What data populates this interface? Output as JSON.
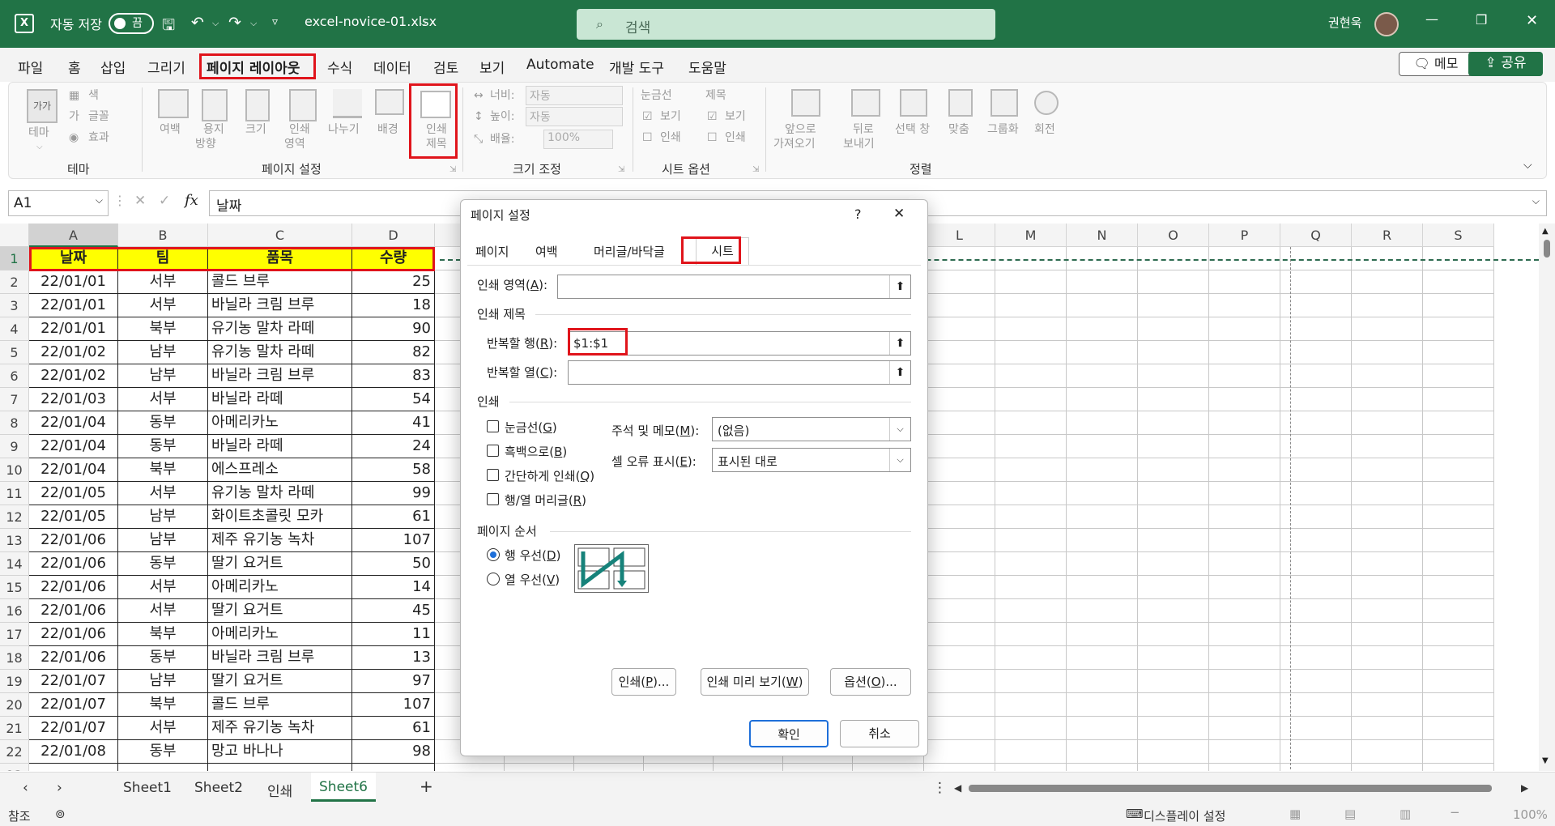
{
  "titlebar": {
    "autosave_label": "자동 저장",
    "autosave_state": "끔",
    "filename": "excel-novice-01.xlsx",
    "search_placeholder": "검색",
    "user_name": "권현욱"
  },
  "menu": {
    "items": [
      "파일",
      "홈",
      "삽입",
      "그리기",
      "페이지 레이아웃",
      "수식",
      "데이터",
      "검토",
      "보기",
      "Automate",
      "개발 도구",
      "도움말"
    ],
    "memo_label": "메모",
    "share_label": "공유"
  },
  "ribbon": {
    "theme": {
      "label": "테마",
      "btn": "테마",
      "color": "색",
      "font": "글꼴",
      "effect": "효과"
    },
    "page_setup": {
      "label": "페이지 설정",
      "margins": "여백",
      "orientation_1": "용지",
      "orientation_2": "방향",
      "size": "크기",
      "print_area_1": "인쇄",
      "print_area_2": "영역",
      "breaks": "나누기",
      "background": "배경",
      "print_titles_1": "인쇄",
      "print_titles_2": "제목"
    },
    "scale": {
      "label": "크기 조정",
      "width": "너비:",
      "width_val": "자동",
      "height": "높이:",
      "height_val": "자동",
      "scale": "배율:",
      "scale_val": "100%"
    },
    "sheet_options": {
      "label": "시트 옵션",
      "gridlines": "눈금선",
      "headings": "제목",
      "view": "보기",
      "print": "인쇄"
    },
    "arrange": {
      "label": "정렬",
      "bring_forward_1": "앞으로",
      "bring_forward_2": "가져오기",
      "send_backward_1": "뒤로",
      "send_backward_2": "보내기",
      "selection_pane": "선택 창",
      "align": "맞춤",
      "group": "그룹화",
      "rotate": "회전"
    }
  },
  "formula_bar": {
    "name_box": "A1",
    "fx": "fx",
    "value": "날짜"
  },
  "grid": {
    "columns": [
      "A",
      "B",
      "C",
      "D",
      "E",
      "F",
      "G",
      "H",
      "I",
      "J",
      "K",
      "L",
      "M",
      "N",
      "O",
      "P",
      "Q",
      "R",
      "S"
    ],
    "header_row": [
      "날짜",
      "팀",
      "품목",
      "수량"
    ],
    "rows": [
      [
        "22/01/01",
        "서부",
        "콜드 브루",
        "25"
      ],
      [
        "22/01/01",
        "서부",
        "바닐라 크림 브루",
        "18"
      ],
      [
        "22/01/01",
        "북부",
        "유기농 말차 라떼",
        "90"
      ],
      [
        "22/01/02",
        "남부",
        "유기농 말차 라떼",
        "82"
      ],
      [
        "22/01/02",
        "남부",
        "바닐라 크림 브루",
        "83"
      ],
      [
        "22/01/03",
        "서부",
        "바닐라 라떼",
        "54"
      ],
      [
        "22/01/04",
        "동부",
        "아메리카노",
        "41"
      ],
      [
        "22/01/04",
        "동부",
        "바닐라 라떼",
        "24"
      ],
      [
        "22/01/04",
        "북부",
        "에스프레소",
        "58"
      ],
      [
        "22/01/05",
        "서부",
        "유기농 말차 라떼",
        "99"
      ],
      [
        "22/01/05",
        "남부",
        "화이트초콜릿 모카",
        "61"
      ],
      [
        "22/01/06",
        "남부",
        "제주 유기농 녹차",
        "107"
      ],
      [
        "22/01/06",
        "동부",
        "딸기 요거트",
        "50"
      ],
      [
        "22/01/06",
        "서부",
        "아메리카노",
        "14"
      ],
      [
        "22/01/06",
        "서부",
        "딸기 요거트",
        "45"
      ],
      [
        "22/01/06",
        "북부",
        "아메리카노",
        "11"
      ],
      [
        "22/01/06",
        "동부",
        "바닐라 크림 브루",
        "13"
      ],
      [
        "22/01/07",
        "남부",
        "딸기 요거트",
        "97"
      ],
      [
        "22/01/07",
        "북부",
        "콜드 브루",
        "107"
      ],
      [
        "22/01/07",
        "서부",
        "제주 유기농 녹차",
        "61"
      ],
      [
        "22/01/08",
        "동부",
        "망고 바나나",
        "98"
      ]
    ]
  },
  "sheets": {
    "tabs": [
      "Sheet1",
      "Sheet2",
      "인쇄",
      "Sheet6"
    ],
    "active": "Sheet6",
    "add": "+"
  },
  "status": {
    "ready": "참조",
    "display_settings": "디스플레이 설정",
    "zoom": "100%"
  },
  "dialog": {
    "title": "페이지 설정",
    "help": "?",
    "close": "✕",
    "tabs": [
      "페이지",
      "여백",
      "머리글/바닥글",
      "시트"
    ],
    "print_area_label": "인쇄 영역(",
    "print_area_key": "A",
    "print_area_end": "):",
    "print_titles_section": "인쇄 제목",
    "rows_repeat_label": "반복할 행(",
    "rows_repeat_key": "R",
    "rows_repeat_end": "):",
    "rows_repeat_value": "$1:$1",
    "cols_repeat_label": "반복할 열(",
    "cols_repeat_key": "C",
    "cols_repeat_end": "):",
    "print_section": "인쇄",
    "chk_gridlines": "눈금선(",
    "chk_gridlines_key": "G",
    "chk_bw": "흑백으로(",
    "chk_bw_key": "B",
    "chk_draft": "간단하게 인쇄(",
    "chk_draft_key": "Q",
    "chk_headings": "행/열 머리글(",
    "chk_headings_key": "R",
    "comments_label": "주석 및 메모(",
    "comments_key": "M",
    "comments_value": "(없음)",
    "errors_label": "셀 오류 표시(",
    "errors_key": "E",
    "errors_value": "표시된 대로",
    "page_order_section": "페이지 순서",
    "radio_down": "행 우선(",
    "radio_down_key": "D",
    "radio_over": "열 우선(",
    "radio_over_key": "V",
    "btn_print": "인쇄(",
    "btn_print_key": "P",
    "btn_print_end": ")...",
    "btn_preview": "인쇄 미리 보기(",
    "btn_preview_key": "W",
    "btn_options": "옵션(",
    "btn_options_key": "O",
    "btn_options_end": ")...",
    "btn_ok": "확인",
    "btn_cancel": "취소"
  },
  "colors": {
    "excel_green": "#217346",
    "highlight_red": "#e0141b",
    "header_yellow": "#ffff00"
  }
}
